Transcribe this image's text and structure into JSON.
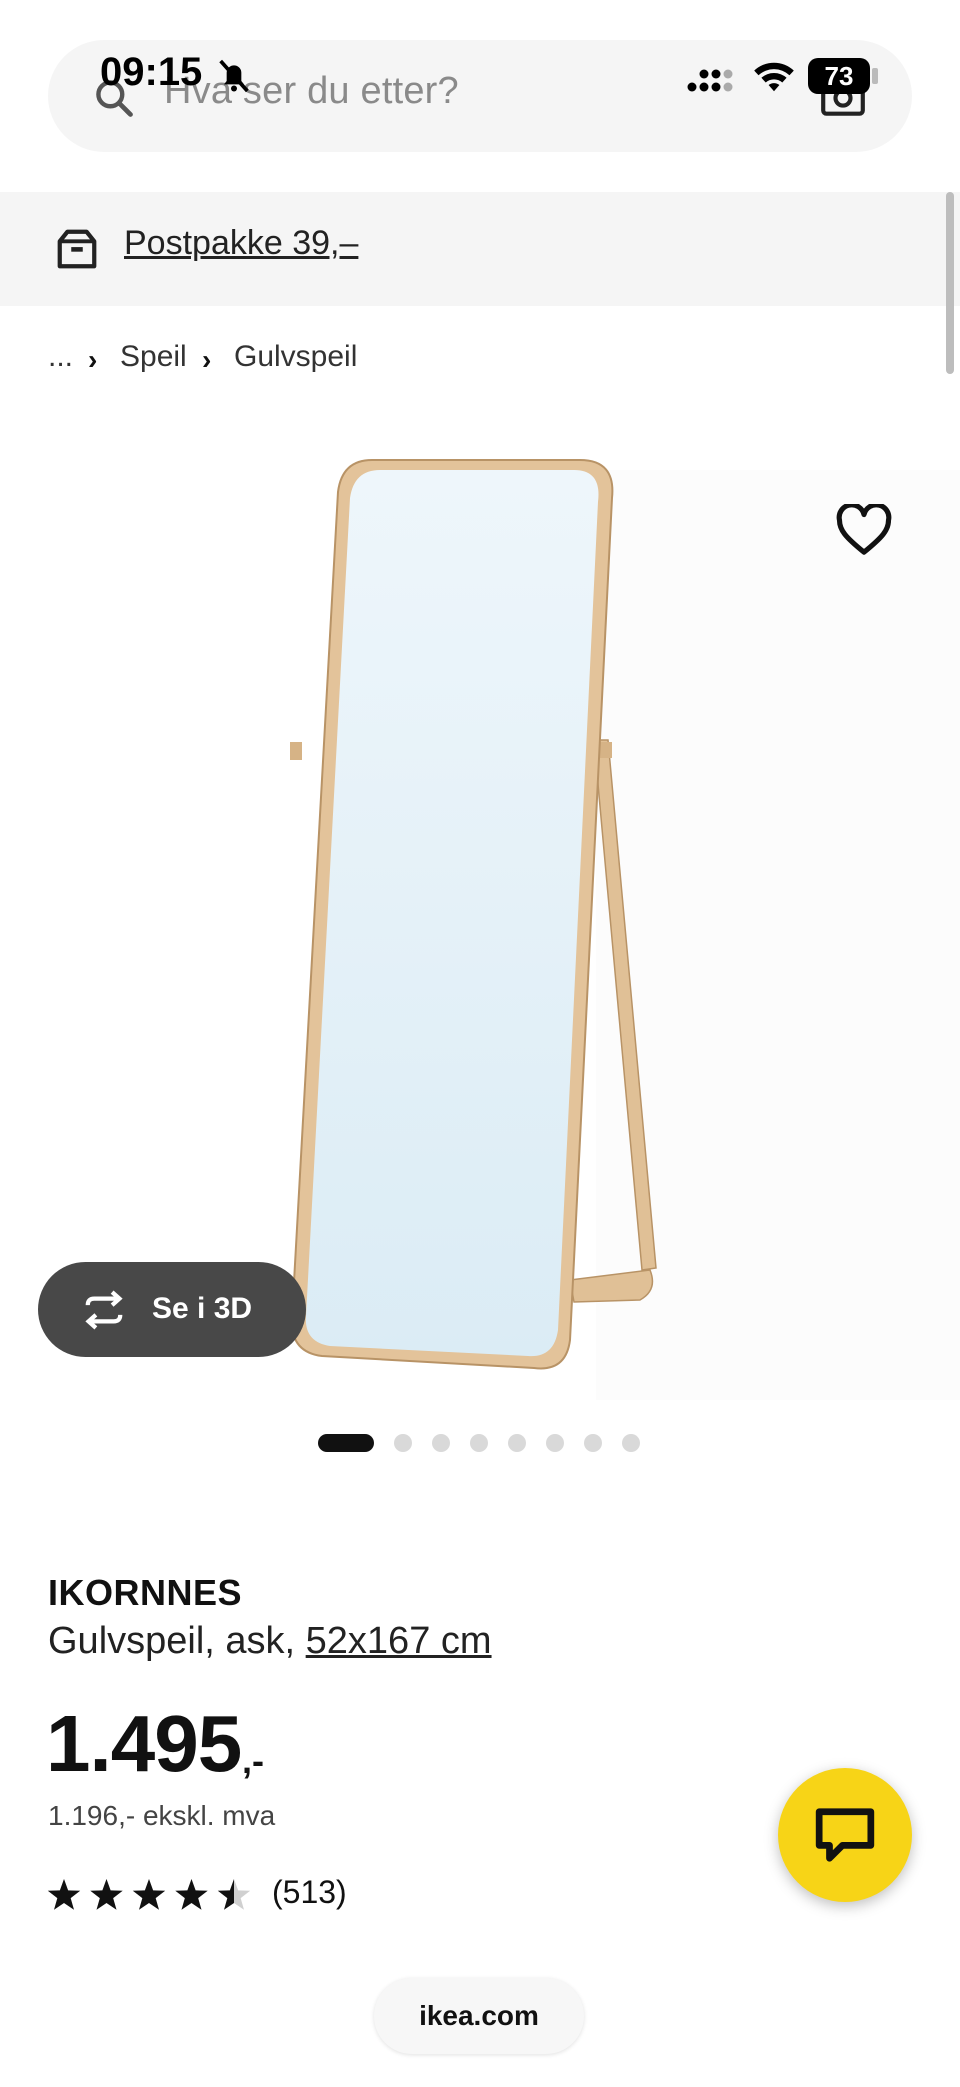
{
  "status_bar": {
    "time": "09:15",
    "battery": "73"
  },
  "search": {
    "placeholder": "Hva ser du etter?"
  },
  "banner": {
    "text": "Postpakke 39,–"
  },
  "breadcrumb": {
    "items": [
      "...",
      "Speil",
      "Gulvspeil"
    ]
  },
  "product": {
    "name": "IKORNNES",
    "description": "Gulvspeil, ask, ",
    "dimension": "52x167 cm",
    "price": "1.495",
    "price_suffix": ",-",
    "price_ex_vat": "1.196,- ekskl. mva",
    "rating": 4.5,
    "rating_max": 5,
    "rating_count": "(513)"
  },
  "view_3d": {
    "label": "Se i 3D"
  },
  "carousel": {
    "total": 8,
    "active_index": 0
  },
  "footer": {
    "url": "ikea.com"
  },
  "colors": {
    "accent": "#f7d417",
    "dark_button": "#484848",
    "banner_bg": "#f5f5f5"
  },
  "icons": [
    "search-icon",
    "camera-icon",
    "bell-slash-icon",
    "signal-icon",
    "wifi-icon",
    "box-icon",
    "heart-icon",
    "rotate-3d-icon",
    "chat-icon",
    "star-icon"
  ]
}
